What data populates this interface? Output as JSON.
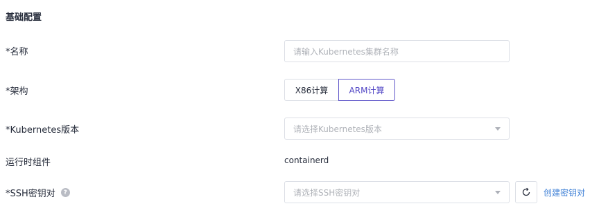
{
  "section": {
    "title": "基础配置"
  },
  "name_row": {
    "label": "*名称",
    "placeholder": "请输入Kubernetes集群名称"
  },
  "arch_row": {
    "label": "*架构",
    "options": [
      "X86计算",
      "ARM计算"
    ],
    "selected": "ARM计算"
  },
  "version_row": {
    "label": "*Kubernetes版本",
    "placeholder": "请选择Kubernetes版本"
  },
  "runtime_row": {
    "label": "运行时组件",
    "value": "containerd"
  },
  "ssh_row": {
    "label": "*SSH密钥对",
    "help": "?",
    "placeholder": "请选择SSH密钥对",
    "create_link": "创建密钥对"
  },
  "colors": {
    "accent": "#4f44c4",
    "link": "#3d7fd6",
    "border": "#dcdfe6"
  }
}
